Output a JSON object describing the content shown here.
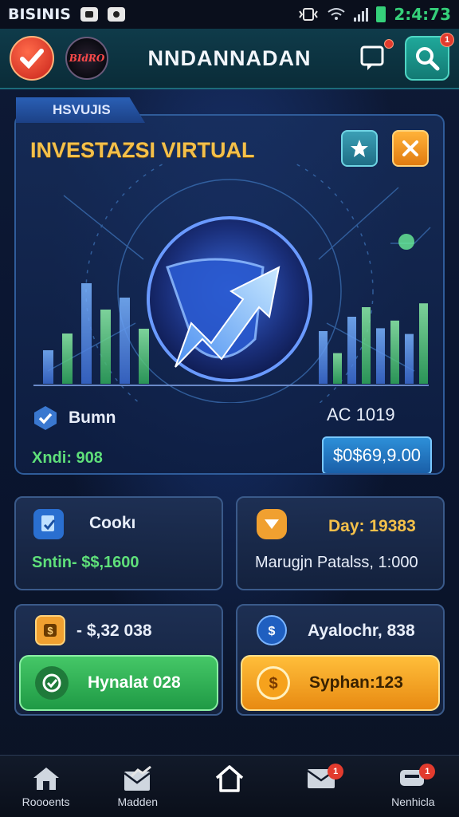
{
  "status_bar": {
    "carrier": "BISINIS",
    "time": "2:4:73"
  },
  "app_bar": {
    "title": "NNDANNADAN",
    "avatar_text": "BIdRO",
    "notification_badge": "1"
  },
  "hero": {
    "tab_label": "HSVUJIS",
    "title": "INVESTAZSI VIRTUAL",
    "left_metric_label": "Bumn",
    "left_metric_value": "Xndi: 908",
    "right_metric_label": "AC 1019",
    "right_metric_value": "$0$69,9.00",
    "left_bars": [
      0.28,
      0.42,
      0.84,
      0.62,
      0.72,
      0.46
    ],
    "right_bars": [
      0.55,
      0.32,
      0.7,
      0.8,
      0.58,
      0.66,
      0.52,
      0.84
    ]
  },
  "cards": {
    "c1": {
      "title": "Cookı",
      "value": "Sntin-  $$,1600",
      "value_color": "#5fe07a"
    },
    "c2": {
      "title": "Day: 19383",
      "value": "Marugjn Patalss, 1:000",
      "title_color": "#f4c04a"
    },
    "c3": {
      "title": "- $,32 038",
      "button_label": "Hynalat 028"
    },
    "c4": {
      "title": "Ayalochr, 838",
      "button_label": "Syphan:123"
    }
  },
  "bottom_nav": [
    {
      "label": "Roooents",
      "icon": "home-icon",
      "badge": ""
    },
    {
      "label": "Madden",
      "icon": "chart-mail-icon",
      "badge": ""
    },
    {
      "label": "",
      "icon": "house-outline-icon",
      "badge": ""
    },
    {
      "label": "",
      "icon": "mail-icon",
      "badge": "1"
    },
    {
      "label": "Nenhicla",
      "icon": "chat-icon",
      "badge": "1"
    }
  ],
  "colors": {
    "accent_gold": "#f4c04a",
    "accent_green": "#5fe07a",
    "header_teal": "#0f3b4a",
    "button_orange": "#e88a12"
  }
}
